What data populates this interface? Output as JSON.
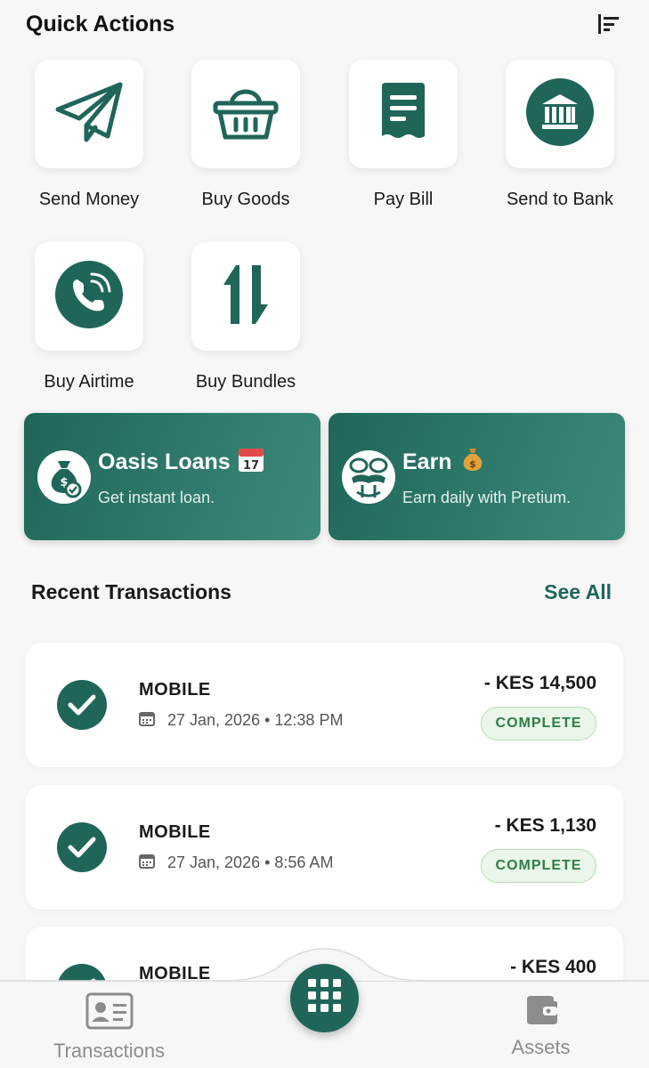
{
  "header": {
    "title": "Quick Actions",
    "menu_icon": "align-left-menu-icon"
  },
  "quick_actions": [
    {
      "label": "Send Money",
      "icon": "paper-plane-icon"
    },
    {
      "label": "Buy Goods",
      "icon": "shopping-basket-icon"
    },
    {
      "label": "Pay Bill",
      "icon": "receipt-icon"
    },
    {
      "label": "Send to Bank",
      "icon": "bank-icon"
    },
    {
      "label": "Buy Airtime",
      "icon": "phone-call-icon"
    },
    {
      "label": "Buy Bundles",
      "icon": "data-arrows-icon"
    }
  ],
  "promos": [
    {
      "title": "Oasis Loans",
      "emoji": "📅",
      "emoji_text": "17",
      "subtitle": "Get instant loan.",
      "icon": "money-bag-icon"
    },
    {
      "title": "Earn",
      "emoji": "💰",
      "subtitle": "Earn daily with Pretium.",
      "icon": "coins-hand-icon"
    }
  ],
  "recent": {
    "title": "Recent Transactions",
    "see_all": "See All",
    "items": [
      {
        "type": "MOBILE",
        "date": "27 Jan, 2026 • 12:38 PM",
        "amount": "- KES 14,500",
        "status": "COMPLETE"
      },
      {
        "type": "MOBILE",
        "date": "27 Jan, 2026 • 8:56 AM",
        "amount": "- KES 1,130",
        "status": "COMPLETE"
      },
      {
        "type": "MOBILE",
        "date": "",
        "amount": "- KES 400",
        "status": ""
      }
    ]
  },
  "bottom_nav": {
    "left_label": "Transactions",
    "right_label": "Assets",
    "center_icon": "grid-apps-icon"
  },
  "colors": {
    "primary": "#1f6659",
    "status_bg": "#e9f6e9",
    "status_text": "#2e7d45"
  }
}
